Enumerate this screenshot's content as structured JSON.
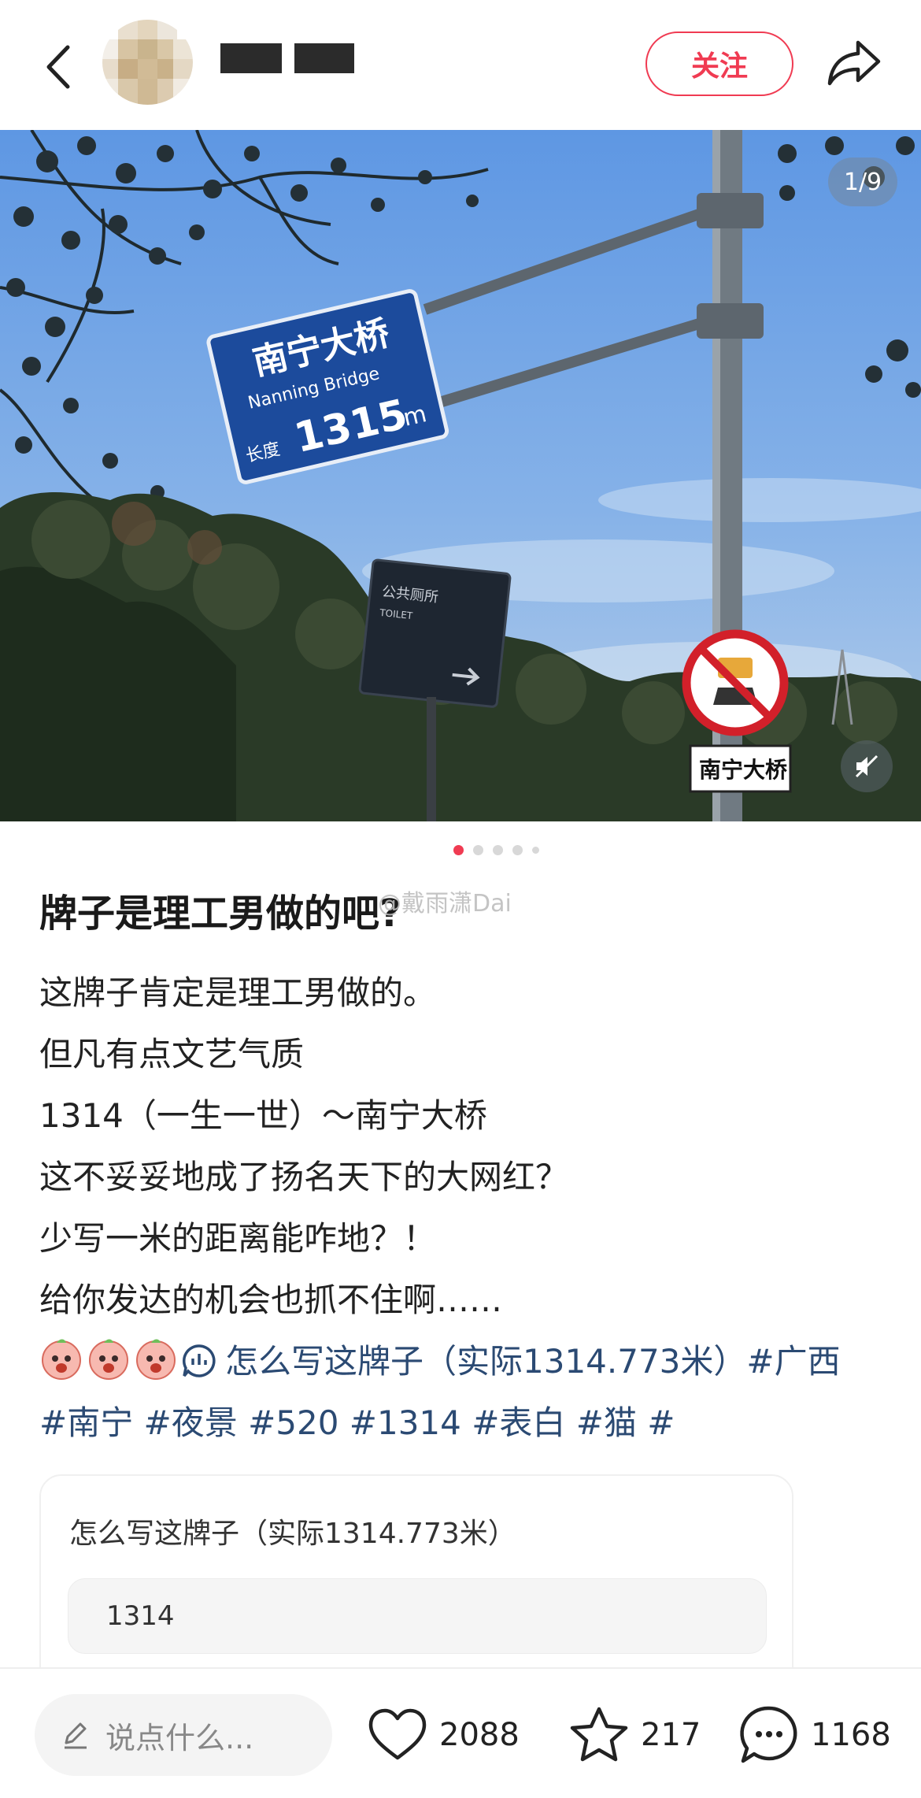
{
  "header": {
    "follow_label": "关注",
    "icons": [
      "back-icon",
      "avatar",
      "share-icon"
    ]
  },
  "photo": {
    "counter": "1/9",
    "dot_count": 5,
    "active_dot": 0
  },
  "post": {
    "title": "牌子是理工男做的吧?",
    "watermark": "@戴雨潇Dai",
    "lines": [
      "这牌子肯定是理工男做的。",
      "但凡有点文艺气质",
      "1314（一生一世）～南宁大桥",
      "这不妥妥地成了扬名天下的大网红？",
      "少写一米的距离能咋地？！",
      "给你发达的机会也抓不住啊……"
    ],
    "tag_line_1": "怎么写这牌子（实际1314.773米）#广西",
    "tag_line_2": "#南宁 #夜景 #520 #1314 #表白 #猫 #"
  },
  "vote": {
    "title": "怎么写这牌子（实际1314.773米）",
    "options": [
      "1314"
    ]
  },
  "bottom": {
    "comment_placeholder": "说点什么...",
    "likes": "2088",
    "stars": "217",
    "comments": "1168"
  },
  "colors": {
    "accent": "#f03b52",
    "tag_blue": "#2b4a73",
    "sign_blue": "#1c4b9c"
  }
}
